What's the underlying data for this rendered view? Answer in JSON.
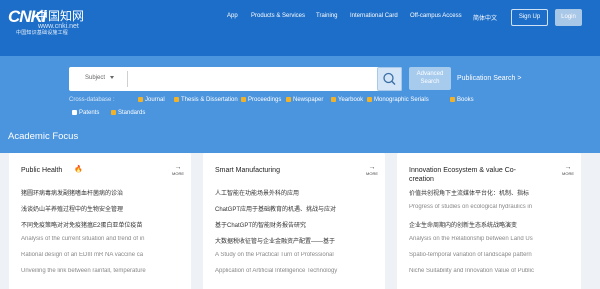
{
  "logo": {
    "mark": "CNKi",
    "cn": "中国知网",
    "url": "www.cnki.net",
    "sub": "中国知识基础设施工程"
  },
  "nav": [
    "App",
    "Products & Services",
    "Training",
    "International Card",
    "Off-campus Access",
    "简体中文"
  ],
  "auth": {
    "signup": "Sign Up",
    "login": "Login"
  },
  "search": {
    "subject": "Subject",
    "advanced_line1": "Advanced",
    "advanced_line2": "Search",
    "publication": "Publication Search >",
    "cross": "Cross-database :",
    "options": [
      {
        "label": "Journal",
        "checked": true
      },
      {
        "label": "Thesis & Dissertation",
        "checked": true
      },
      {
        "label": "Proceedings",
        "checked": true
      },
      {
        "label": "Newspaper",
        "checked": true
      },
      {
        "label": "Yearbook",
        "checked": true
      },
      {
        "label": "Monographic Serials",
        "checked": true
      },
      {
        "label": "Books",
        "checked": true
      },
      {
        "label": "Patents",
        "checked": false
      },
      {
        "label": "Standards",
        "checked": true
      }
    ]
  },
  "focus": {
    "title": "Academic Focus",
    "more": "MORE",
    "cards": [
      {
        "title": "Public Health",
        "lines": [
          "猪圆环病毒病发副猪嗜血杆菌病的诊治",
          "浅谈奶山羊养殖过程中的生物安全管理",
          "不同免疫策略对对免疫猪瘟E2蛋白亚单位疫苗",
          "Analysis of the current situation and trend of in",
          "Rational design of an EDIII mR NA vaccine ca",
          "Unveiling the link between rainfall, temperature"
        ]
      },
      {
        "title": "Smart Manufacturing",
        "lines": [
          "人工智能在功能场景外科的应用",
          "ChatGPT应用于基础教育的机遇、挑战与应对",
          "基于ChatGPT的智能财务报告研究",
          "大数据税收征管与企业金融资产配置——基于",
          "A Study on the Practical Turn of Professional",
          "Application of Artificial Intelligence Technology"
        ]
      },
      {
        "title": "Innovation Ecosystem & value Co-creation",
        "lines": [
          "价值共创视角下主流媒体平台化：机制、指标",
          "Progress of studies on ecological hydraulics in",
          "企业生命周期内的创新生态系统战略演变",
          "Analysis on the Relationship between Land Us",
          "Spatio-temporal variation of landscape pattern",
          "Niche Suitability and Innovation Value of Public"
        ]
      }
    ]
  },
  "colors": {
    "header": "#1d6ec8",
    "band": "#4b94de",
    "check": "#f2b227"
  }
}
